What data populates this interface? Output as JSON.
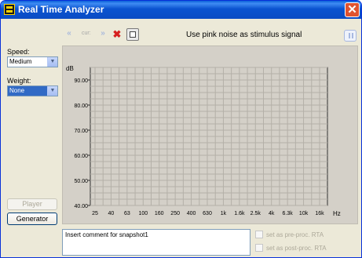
{
  "window": {
    "title": "Real Time Analyzer",
    "close_glyph": "✕"
  },
  "toolbar": {
    "prev_glyph": "«",
    "cur_label": "cur:",
    "next_glyph": "»",
    "delete_glyph": "✖",
    "stimulus_text": "Use pink noise as stimulus signal"
  },
  "left": {
    "speed_label": "Speed:",
    "speed_value": "Medium",
    "weight_label": "Weight:",
    "weight_value": "None",
    "player_button": "Player",
    "generator_button": "Generator"
  },
  "chart_data": {
    "type": "line",
    "ylabel": "dB",
    "xlabel": "Hz",
    "y_ticks": [
      "90.00",
      "80.00",
      "70.00",
      "60.00",
      "50.00",
      "40.00"
    ],
    "ylim": [
      40,
      95
    ],
    "x_ticks": [
      "25",
      "40",
      "63",
      "100",
      "160",
      "250",
      "400",
      "630",
      "1k",
      "1.6k",
      "2.5k",
      "4k",
      "6.3k",
      "10k",
      "16k"
    ],
    "grid": true,
    "series": []
  },
  "bottom": {
    "comment_text": "Insert comment for snapshot1",
    "pre_proc_label": "set as pre-proc. RTA",
    "post_proc_label": "set as post-proc. RTA"
  },
  "colors": {
    "titlebar": "#0a53d0",
    "plot_bg": "#d4d0c8",
    "grid": "#b4b0a8"
  }
}
